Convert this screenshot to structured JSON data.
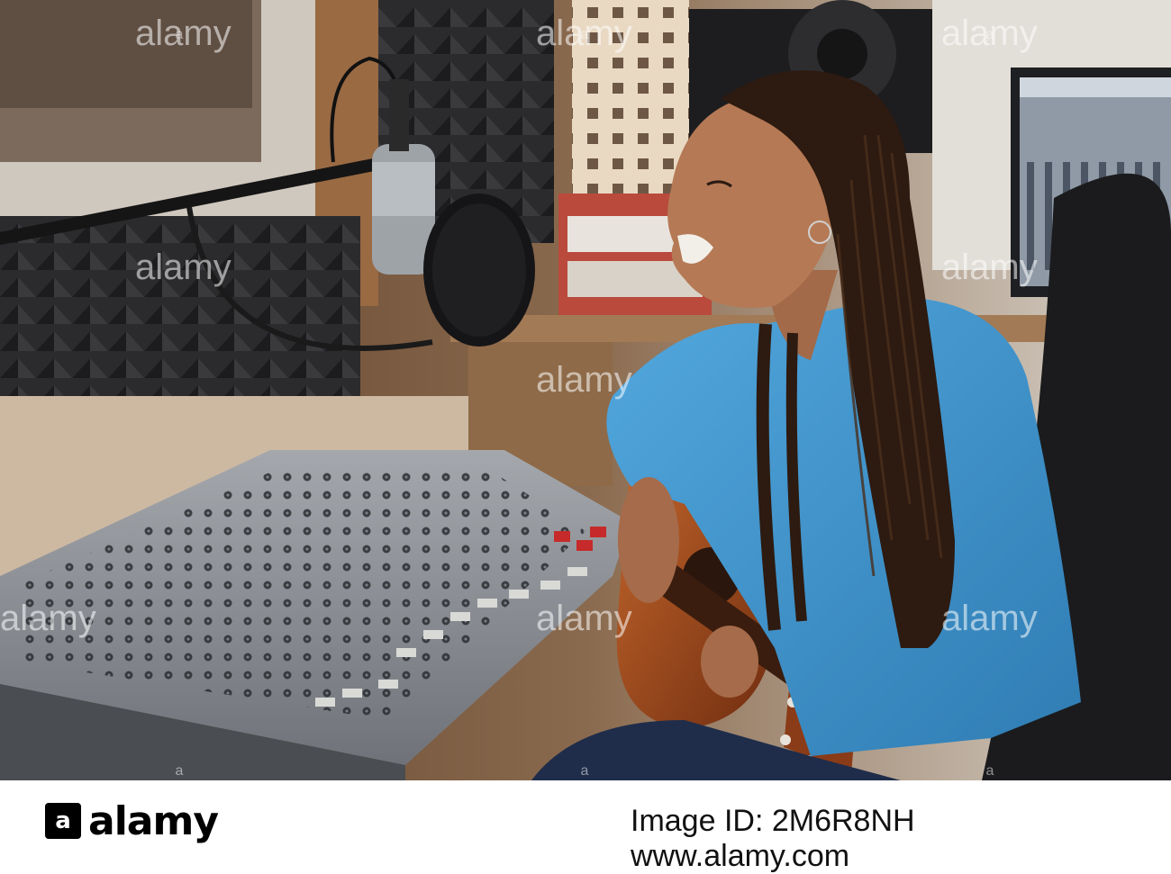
{
  "photo": {
    "description_icon": "studio-photo",
    "watermark_text": "alamy",
    "colors": {
      "hoodie": "#3f93c9",
      "guitar": "#9b4a1f",
      "mixer": "#8d9198",
      "wall": "#6b4a31",
      "foam": "#2a2a2c"
    }
  },
  "footer": {
    "logo_text": "alamy",
    "logo_mark": "a",
    "image_id_label": "Image ID:",
    "image_id": "2M6R8NH",
    "url": "www.alamy.com"
  }
}
